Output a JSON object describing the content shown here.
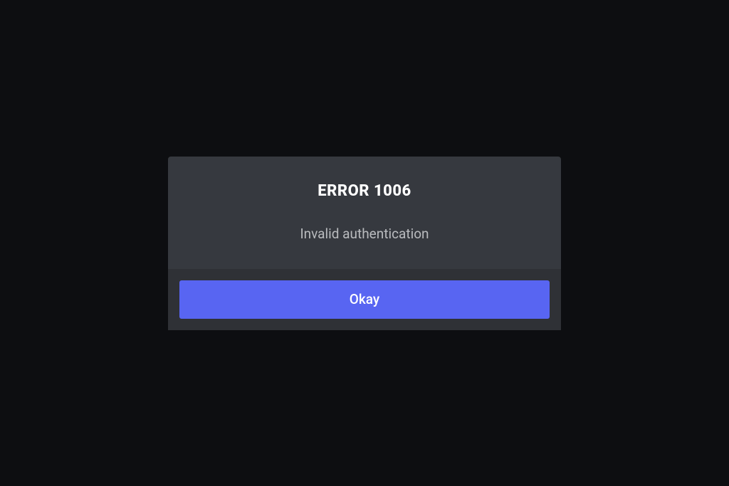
{
  "modal": {
    "title": "ERROR 1006",
    "message": "Invalid authentication",
    "button_label": "Okay"
  }
}
